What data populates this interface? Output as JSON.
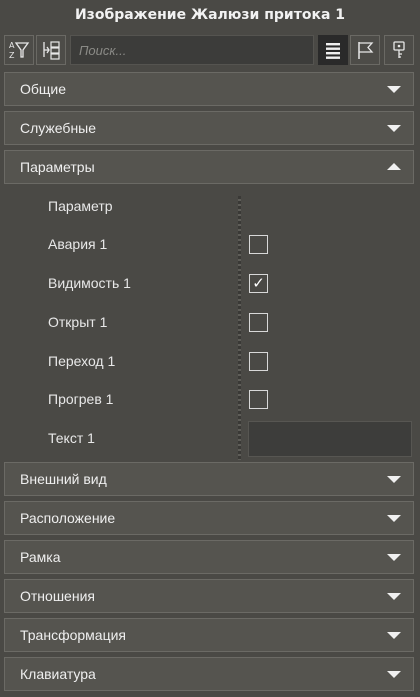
{
  "window": {
    "title": "Изображение Жалюзи притока 1"
  },
  "toolbar": {
    "search_placeholder": "Поиск...",
    "sort_icon": "sort-az-filter-icon",
    "expand_icon": "expand-tree-icon",
    "list_icon": "list-view-icon",
    "flag_icon": "flag-icon",
    "key_icon": "key-icon"
  },
  "sections": {
    "general": "Общие",
    "service": "Служебные",
    "parameters": "Параметры",
    "appearance": "Внешний вид",
    "position": "Расположение",
    "frame": "Рамка",
    "relations": "Отношения",
    "transform": "Трансформация",
    "keyboard": "Клавиатура"
  },
  "parameters": {
    "header": "Параметр",
    "rows": [
      {
        "name": "Авария 1",
        "checked": false
      },
      {
        "name": "Видимость 1",
        "checked": true
      },
      {
        "name": "Открыт 1",
        "checked": false
      },
      {
        "name": "Переход 1",
        "checked": false
      },
      {
        "name": "Прогрев 1",
        "checked": false
      }
    ],
    "text_row": {
      "name": "Текст 1",
      "value": ""
    }
  },
  "checkmark": "✓",
  "colors": {
    "background": "#4a4945",
    "section": "#55544f",
    "active_button": "#2a2a2a"
  }
}
